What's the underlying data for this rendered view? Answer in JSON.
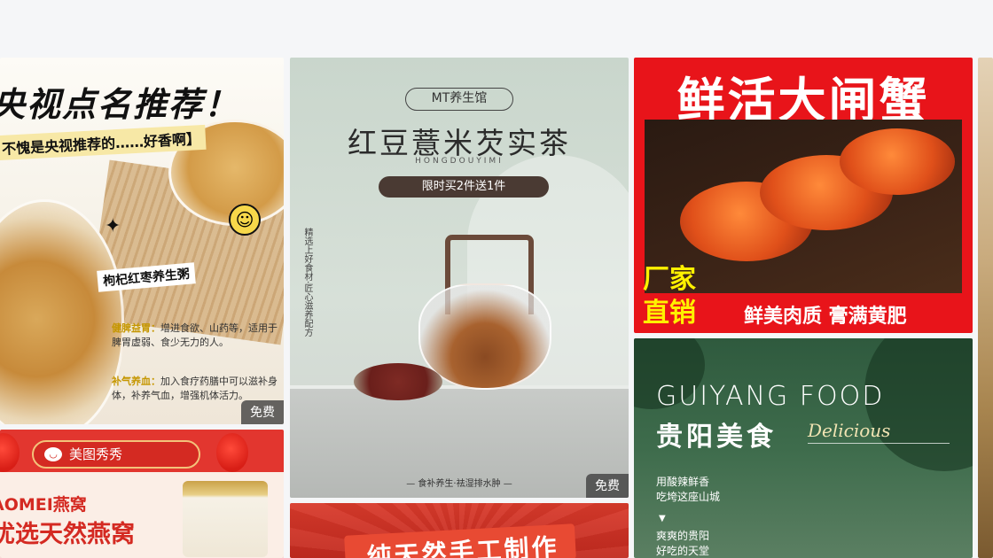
{
  "cards": {
    "congee": {
      "headline": "央视点名推荐！",
      "subheadline": "不愧是央视推荐的……好香啊】",
      "tag": "枸杞红枣养生粥",
      "note1_key": "健脾益胃：",
      "note1_text": "增进食欲、山药等，适用于脾胃虚弱、食少无力的人。",
      "note2_key": "补气养血：",
      "note2_text": "加入食疗药膳中可以滋补身体，补养气血，增强机体活力。",
      "badge": "免费"
    },
    "tea": {
      "brand": "MT养生馆",
      "title": "红豆薏米芡实茶",
      "pinyin": "HONGDOUYIMI",
      "promo": "限时买2件送1件",
      "vertical_text": "精选上好食材·匠心滋养配方",
      "slogan": "— 食补养生·祛湿排水肿 —",
      "badge": "免费"
    },
    "crab": {
      "title": "鲜活大闸蟹",
      "factory_line1": "厂家",
      "factory_line2": "直销",
      "slogan": "鲜美肉质 膏满黄肥"
    },
    "guiyang": {
      "title_en": "GUIYANG FOOD",
      "title_cn": "贵阳美食",
      "script": "Delicious",
      "line1": "用酸辣鲜香",
      "line2": "吃垮这座山城",
      "arrow": "▼",
      "line3": "爽爽的贵阳",
      "line4": "好吃的天堂"
    },
    "birdnest": {
      "logo": "美图秀秀",
      "brand_line": "AOMEI燕窝",
      "slogan": "优选天然燕窝"
    },
    "handmade": {
      "title": "纯天然手工制作"
    }
  },
  "colors": {
    "badge_bg": "#3c3c3c",
    "crab_red": "#e8141a",
    "crab_yellow": "#fff100",
    "tea_promo": "#4a3a33",
    "guiyang_green": "#2f5a3e"
  }
}
